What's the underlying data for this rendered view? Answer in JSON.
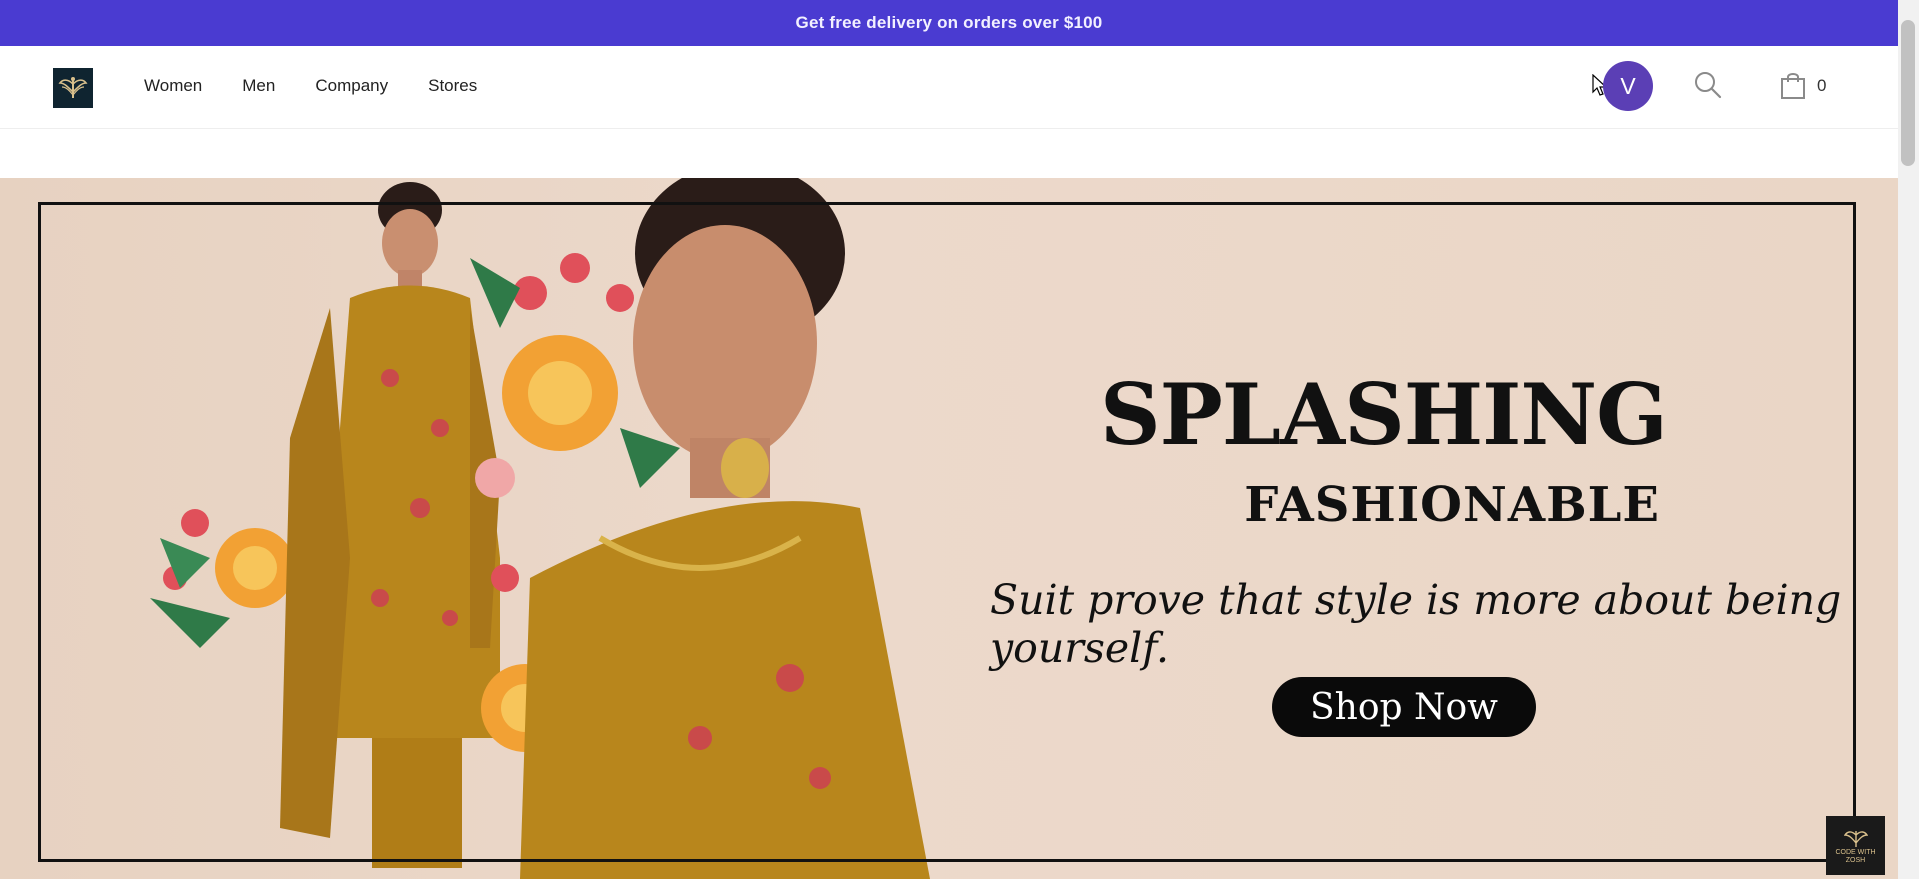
{
  "promo": {
    "text": "Get free delivery on orders over $100"
  },
  "header": {
    "nav": [
      "Women",
      "Men",
      "Company",
      "Stores"
    ],
    "avatar_initial": "V",
    "cart_count": "0"
  },
  "hero": {
    "headline": "SPLASHING",
    "subheadline": "FASHIONABLE",
    "tagline": "Suit prove that style is more about being yourself.",
    "cta_label": "Shop Now"
  },
  "watermark": {
    "text": "CODE WITH ZOSH"
  },
  "colors": {
    "promo_bar": "#4a3bd1",
    "avatar": "#5b3fb5",
    "hero_background": "#e9d5c5",
    "garment": "#b8861c"
  },
  "icons": [
    "brand-logo-icon",
    "mouse-cursor-icon",
    "search-icon",
    "shopping-bag-icon"
  ]
}
